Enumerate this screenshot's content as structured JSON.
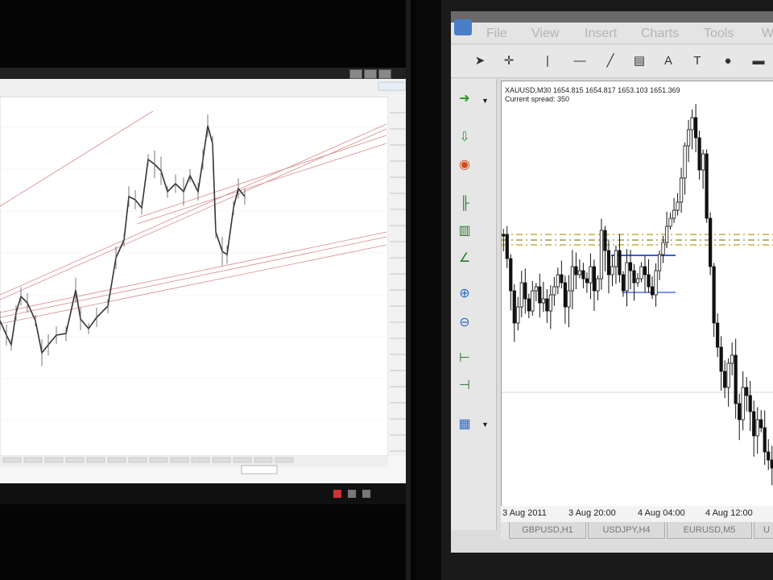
{
  "right_window": {
    "menu": [
      "File",
      "View",
      "Insert",
      "Charts",
      "Tools",
      "W"
    ],
    "chart_header_line1": "XAUUSD,M30  1654.815 1654.817 1653.103 1651.369",
    "chart_header_line2": "Current spread: 350",
    "x_axis_labels": [
      "3 Aug 2011",
      "3 Aug 20:00",
      "4 Aug 04:00",
      "4 Aug 12:00"
    ],
    "tabs": [
      "GBPUSD,H1",
      "USDJPY,H4",
      "EURUSD,M5",
      "U"
    ],
    "colors": {
      "level_line": "#b99b1f",
      "selection": "#3a5fd0",
      "candle": "#111111"
    }
  },
  "icons": [
    "cursor-icon",
    "crosshair-icon",
    "vertical-line-icon",
    "horizontal-line-icon",
    "trendline-icon",
    "channel-icon",
    "text-icon",
    "label-icon",
    "ellipse-icon",
    "rectangle-icon",
    "new-order-icon",
    "zoom-in-icon",
    "zoom-out-icon"
  ]
}
